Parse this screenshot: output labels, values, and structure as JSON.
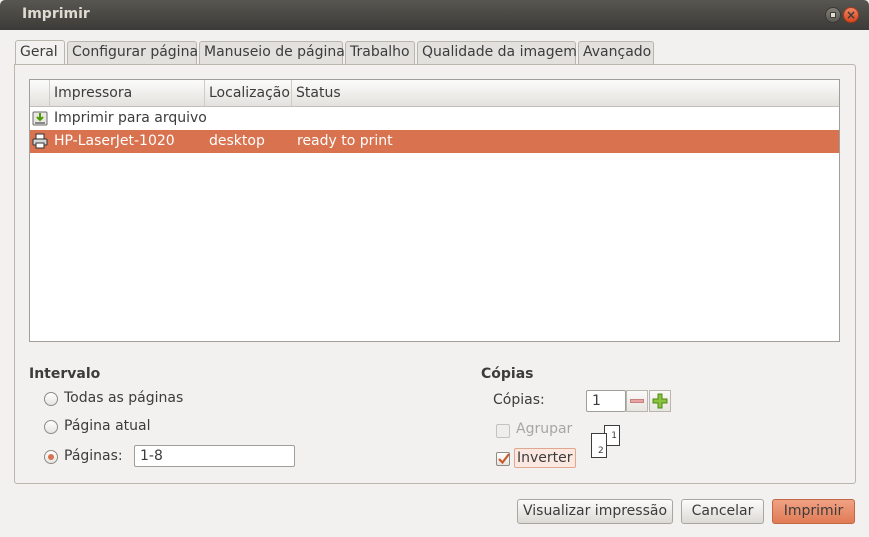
{
  "window": {
    "title": "Imprimir"
  },
  "tabs": [
    {
      "label": "Geral"
    },
    {
      "label": "Configurar página"
    },
    {
      "label": "Manuseio de página"
    },
    {
      "label": "Trabalho"
    },
    {
      "label": "Qualidade da imagem"
    },
    {
      "label": "Avançado"
    }
  ],
  "printer_list": {
    "columns": [
      "Impressora",
      "Localização",
      "Status"
    ],
    "rows": [
      {
        "name": "Imprimir para arquivo",
        "location": "",
        "status": "",
        "icon": "save-to-file-icon",
        "selected": false
      },
      {
        "name": "HP-LaserJet-1020",
        "location": "desktop",
        "status": "ready to print",
        "icon": "printer-icon",
        "selected": true
      }
    ],
    "selection_color": "#d9724f"
  },
  "range": {
    "title": "Intervalo",
    "all_pages": "Todas as páginas",
    "current_page": "Página atual",
    "pages_label": "Páginas:",
    "pages_value": "1-8",
    "selected": "pages"
  },
  "copies": {
    "title": "Cópias",
    "copies_label": "Cópias:",
    "copies_value": "1",
    "collate_label": "Agrupar",
    "collate_checked": false,
    "collate_enabled": false,
    "reverse_label": "Inverter",
    "reverse_checked": true,
    "page_glyph_front": "1",
    "page_glyph_back": "2"
  },
  "buttons": {
    "preview": "Visualizar impressão",
    "cancel": "Cancelar",
    "print": "Imprimir"
  },
  "colors": {
    "accent": "#d9724f",
    "titlebar": "#3c3b37"
  }
}
